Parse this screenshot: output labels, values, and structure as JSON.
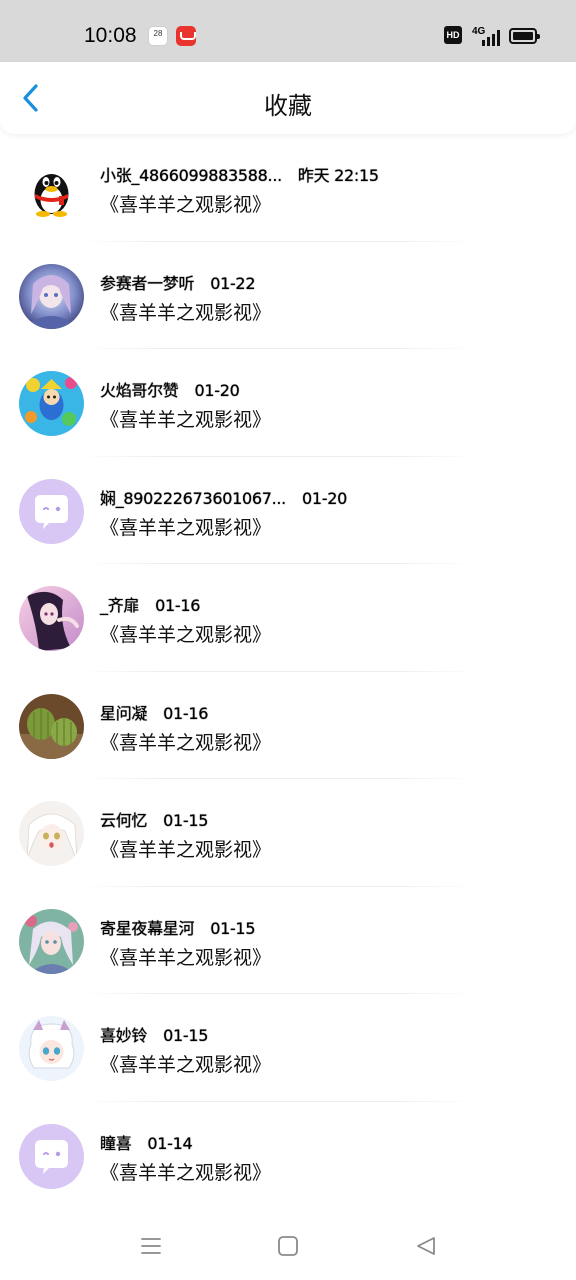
{
  "status_bar": {
    "time": "10:08",
    "calendar_day": "28",
    "calendar_label": "周二",
    "hd": "HD",
    "network": "4G"
  },
  "header": {
    "title": "收藏",
    "back_icon": "chevron-left-icon",
    "accent": "#1a8fe0"
  },
  "items": [
    {
      "name": "小张_4866099883588...",
      "date": "昨天 22:15",
      "content": "《喜羊羊之观影视》",
      "avatar": "qq-penguin"
    },
    {
      "name": "参赛者一梦听",
      "date": "01-22",
      "content": "《喜羊羊之观影视》",
      "avatar": "anime-girl-blue"
    },
    {
      "name": "火焰哥尔赞",
      "date": "01-20",
      "content": "《喜羊羊之观影视》",
      "avatar": "cartoon-colorful"
    },
    {
      "name": "娴_890222673601067...",
      "date": "01-20",
      "content": "《喜羊羊之观影视》",
      "avatar": "default-chat"
    },
    {
      "name": "_齐扉",
      "date": "01-16",
      "content": "《喜羊羊之观影视》",
      "avatar": "anime-girl-pink"
    },
    {
      "name": "星问凝",
      "date": "01-16",
      "content": "《喜羊羊之观影视》",
      "avatar": "cactus"
    },
    {
      "name": "云何忆",
      "date": "01-15",
      "content": "《喜羊羊之观影视》",
      "avatar": "anime-girl-white"
    },
    {
      "name": "寄星夜幕星河",
      "date": "01-15",
      "content": "《喜羊羊之观影视》",
      "avatar": "anime-girl-teal"
    },
    {
      "name": "喜妙铃",
      "date": "01-15",
      "content": "《喜羊羊之观影视》",
      "avatar": "chibi-girl"
    },
    {
      "name": "瞳喜",
      "date": "01-14",
      "content": "《喜羊羊之观影视》",
      "avatar": "default-chat"
    }
  ],
  "nav": {
    "menu_icon": "menu-icon",
    "home_icon": "home-icon",
    "back_icon": "back-triangle-icon"
  }
}
